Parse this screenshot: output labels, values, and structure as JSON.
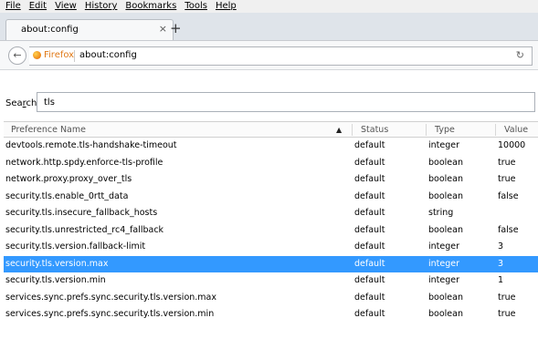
{
  "menu": [
    "File",
    "Edit",
    "View",
    "History",
    "Bookmarks",
    "Tools",
    "Help"
  ],
  "tab": {
    "title": "about:config",
    "close": "×",
    "new_tab": "+"
  },
  "navbar": {
    "identity": "Firefox",
    "url": "about:config",
    "back": "←",
    "reload": "↻"
  },
  "search": {
    "label": "Search:",
    "value": "tls"
  },
  "columns": {
    "name": "Preference Name",
    "status": "Status",
    "type": "Type",
    "value": "Value",
    "sort_indicator": "▲"
  },
  "rows": [
    {
      "name": "devtools.remote.tls-handshake-timeout",
      "status": "default",
      "type": "integer",
      "value": "10000"
    },
    {
      "name": "network.http.spdy.enforce-tls-profile",
      "status": "default",
      "type": "boolean",
      "value": "true"
    },
    {
      "name": "network.proxy.proxy_over_tls",
      "status": "default",
      "type": "boolean",
      "value": "true"
    },
    {
      "name": "security.tls.enable_0rtt_data",
      "status": "default",
      "type": "boolean",
      "value": "false"
    },
    {
      "name": "security.tls.insecure_fallback_hosts",
      "status": "default",
      "type": "string",
      "value": ""
    },
    {
      "name": "security.tls.unrestricted_rc4_fallback",
      "status": "default",
      "type": "boolean",
      "value": "false"
    },
    {
      "name": "security.tls.version.fallback-limit",
      "status": "default",
      "type": "integer",
      "value": "3"
    },
    {
      "name": "security.tls.version.max",
      "status": "default",
      "type": "integer",
      "value": "3",
      "selected": true
    },
    {
      "name": "security.tls.version.min",
      "status": "default",
      "type": "integer",
      "value": "1"
    },
    {
      "name": "services.sync.prefs.sync.security.tls.version.max",
      "status": "default",
      "type": "boolean",
      "value": "true"
    },
    {
      "name": "services.sync.prefs.sync.security.tls.version.min",
      "status": "default",
      "type": "boolean",
      "value": "true"
    }
  ],
  "colors": {
    "selection": "#3399ff",
    "firefox_orange": "#e07a19",
    "tabstrip": "#dfe4ea"
  }
}
